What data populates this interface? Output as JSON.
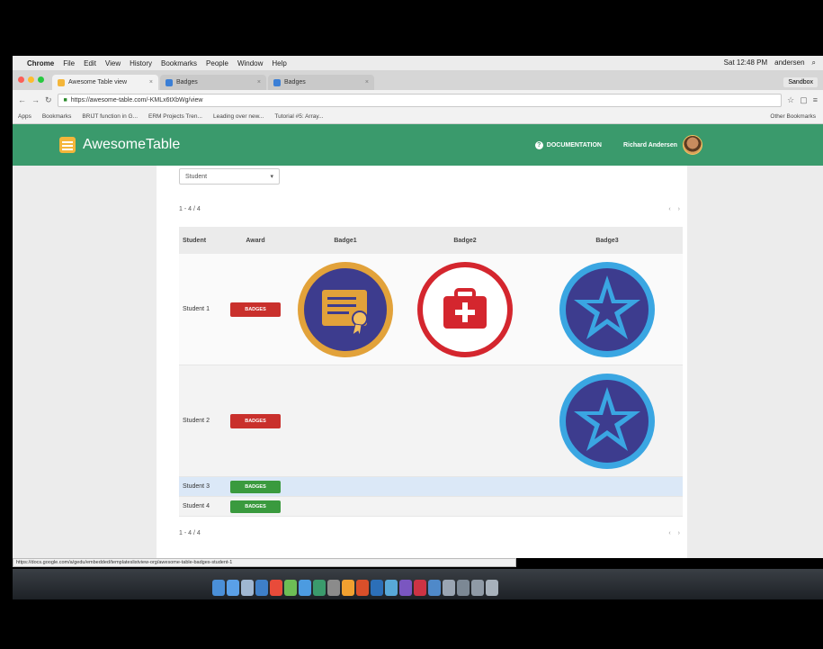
{
  "menubar": {
    "app": "Chrome",
    "items": [
      "File",
      "Edit",
      "View",
      "History",
      "Bookmarks",
      "People",
      "Window",
      "Help"
    ],
    "clock": "Sat 12:48 PM",
    "user": "andersen"
  },
  "tabs": [
    {
      "label": "Awesome Table view"
    },
    {
      "label": "Badges"
    },
    {
      "label": "Badges"
    }
  ],
  "profile_button": "Sandbox",
  "address": {
    "url": "https://awesome-table.com/-KMLx6tXbWg/view"
  },
  "bookmarks": {
    "items": [
      "Apps",
      "Bookmarks",
      "BRIJT function in G...",
      "ERM Projects Tren...",
      "Leading over new...",
      "Tutorial #5: Array..."
    ],
    "other": "Other Bookmarks"
  },
  "header": {
    "brand": "AwesomeTable",
    "documentation": "DOCUMENTATION",
    "user_name": "Richard Andersen"
  },
  "filter": {
    "value": "Student",
    "caret": "▾"
  },
  "pager_top": {
    "text": "1 - 4 / 4",
    "arrows": "‹ ›"
  },
  "pager_bottom": {
    "text": "1 - 4 / 4",
    "arrows": "‹ ›"
  },
  "table": {
    "headers": [
      "Student",
      "Award",
      "Badge1",
      "Badge2",
      "Badge3"
    ],
    "rows": [
      {
        "student": "Student 1",
        "award": "BADGES",
        "badges": [
          "certificate-badge",
          "first-aid-badge",
          "star-badge"
        ]
      },
      {
        "student": "Student 2",
        "award": "BADGES",
        "badges": [
          "",
          "",
          "star-badge"
        ]
      },
      {
        "student": "Student 3",
        "award": "BADGES",
        "badges": []
      },
      {
        "student": "Student 4",
        "award": "BADGES",
        "badges": []
      }
    ]
  },
  "status_url": "https://docs.google.com/a/gedu/embedded/templateslistview-org/awesome-table-badges-student-1",
  "colors": {
    "brand_green": "#3a9a6c",
    "award_red": "#c9302c",
    "award_green": "#3a9a3e",
    "badge_navy": "#3d3c8e",
    "badge_gold": "#e2a23a",
    "badge_red": "#d4262e",
    "badge_sky": "#3aa6e2",
    "highlight_row": "#dbe8f7"
  }
}
